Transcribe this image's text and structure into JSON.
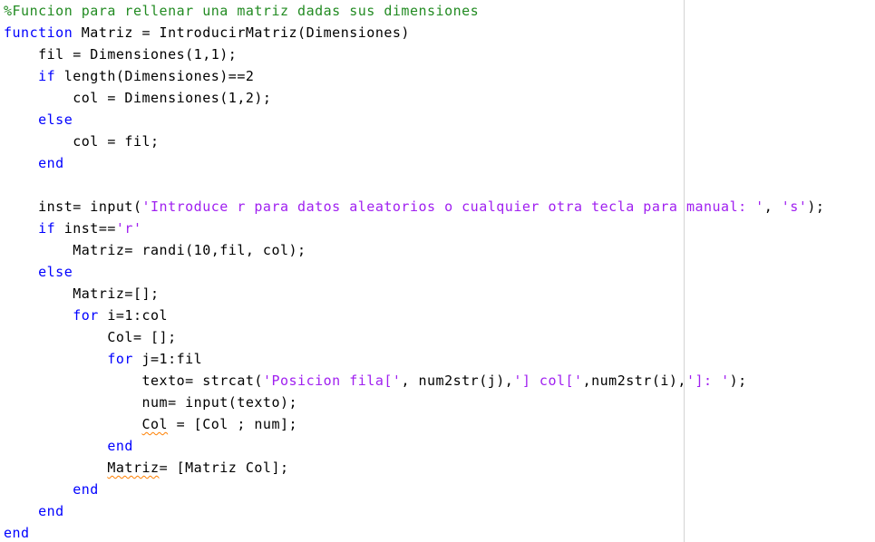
{
  "colors": {
    "background": "#ffffff",
    "comment": "#228b22",
    "keyword": "#0000ff",
    "string": "#a020f0",
    "text": "#000000",
    "warning_underline": "#ff7f00",
    "right_margin": "#d4d4d4"
  },
  "code": {
    "lines": [
      [
        {
          "t": "comment",
          "s": "%Funcion para rellenar una matriz dadas sus dimensiones"
        }
      ],
      [
        {
          "t": "keyword",
          "s": "function"
        },
        {
          "t": "text",
          "s": " Matriz = IntroducirMatriz(Dimensiones)"
        }
      ],
      [
        {
          "t": "text",
          "s": "    fil = Dimensiones(1,1);"
        }
      ],
      [
        {
          "t": "text",
          "s": "    "
        },
        {
          "t": "keyword",
          "s": "if"
        },
        {
          "t": "text",
          "s": " length(Dimensiones)==2"
        }
      ],
      [
        {
          "t": "text",
          "s": "        col = Dimensiones(1,2);"
        }
      ],
      [
        {
          "t": "text",
          "s": "    "
        },
        {
          "t": "keyword",
          "s": "else"
        }
      ],
      [
        {
          "t": "text",
          "s": "        col = fil;"
        }
      ],
      [
        {
          "t": "text",
          "s": "    "
        },
        {
          "t": "keyword",
          "s": "end"
        }
      ],
      [
        {
          "t": "text",
          "s": ""
        }
      ],
      [
        {
          "t": "text",
          "s": "    inst= input("
        },
        {
          "t": "string",
          "s": "'Introduce r para datos aleatorios o cualquier otra tecla para manual: '"
        },
        {
          "t": "text",
          "s": ", "
        },
        {
          "t": "string",
          "s": "'s'"
        },
        {
          "t": "text",
          "s": ");"
        }
      ],
      [
        {
          "t": "text",
          "s": "    "
        },
        {
          "t": "keyword",
          "s": "if"
        },
        {
          "t": "text",
          "s": " inst=="
        },
        {
          "t": "string",
          "s": "'r'"
        }
      ],
      [
        {
          "t": "text",
          "s": "        Matriz= randi(10,fil, col);"
        }
      ],
      [
        {
          "t": "text",
          "s": "    "
        },
        {
          "t": "keyword",
          "s": "else"
        }
      ],
      [
        {
          "t": "text",
          "s": "        Matriz=[];"
        }
      ],
      [
        {
          "t": "text",
          "s": "        "
        },
        {
          "t": "keyword",
          "s": "for"
        },
        {
          "t": "text",
          "s": " i=1:col"
        }
      ],
      [
        {
          "t": "text",
          "s": "            Col= [];"
        }
      ],
      [
        {
          "t": "text",
          "s": "            "
        },
        {
          "t": "keyword",
          "s": "for"
        },
        {
          "t": "text",
          "s": " j=1:fil"
        }
      ],
      [
        {
          "t": "text",
          "s": "                texto= strcat("
        },
        {
          "t": "string",
          "s": "'Posicion fila['"
        },
        {
          "t": "text",
          "s": ", num2str(j),"
        },
        {
          "t": "string",
          "s": "'] col['"
        },
        {
          "t": "text",
          "s": ",num2str(i),"
        },
        {
          "t": "string",
          "s": "']: '"
        },
        {
          "t": "text",
          "s": ");"
        }
      ],
      [
        {
          "t": "text",
          "s": "                num= input(texto);"
        }
      ],
      [
        {
          "t": "text",
          "s": "                "
        },
        {
          "t": "warn",
          "s": "Col"
        },
        {
          "t": "text",
          "s": " = [Col ; num];"
        }
      ],
      [
        {
          "t": "text",
          "s": "            "
        },
        {
          "t": "keyword",
          "s": "end"
        }
      ],
      [
        {
          "t": "text",
          "s": "            "
        },
        {
          "t": "warn",
          "s": "Matriz"
        },
        {
          "t": "text",
          "s": "= [Matriz Col];"
        }
      ],
      [
        {
          "t": "text",
          "s": "        "
        },
        {
          "t": "keyword",
          "s": "end"
        }
      ],
      [
        {
          "t": "text",
          "s": "    "
        },
        {
          "t": "keyword",
          "s": "end"
        }
      ],
      [
        {
          "t": "keyword",
          "s": "end"
        }
      ]
    ]
  }
}
